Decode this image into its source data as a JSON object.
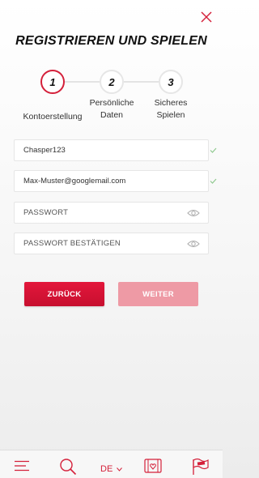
{
  "header": {
    "title": "REGISTRIEREN UND SPIELEN"
  },
  "steps": [
    {
      "number": "1",
      "label": "Kontoerstellung",
      "active": true
    },
    {
      "number": "2",
      "label_line1": "Persönliche",
      "label_line2": "Daten",
      "active": false
    },
    {
      "number": "3",
      "label_line1": "Sicheres",
      "label_line2": "Spielen",
      "active": false
    }
  ],
  "form": {
    "username_value": "Chasper123",
    "email_value": "Max-Muster@googlemail.com",
    "password_placeholder": "PASSWORT",
    "confirm_password_placeholder": "PASSWORT BESTÄTIGEN"
  },
  "buttons": {
    "back_label": "ZURÜCK",
    "next_label": "WEITER"
  },
  "bottom_nav": {
    "language": "DE"
  },
  "colors": {
    "accent": "#d4203a",
    "check": "#8fc98f",
    "next_disabled": "#ee9aa5"
  },
  "icons": {
    "close": "close-icon",
    "check": "check-icon",
    "eye": "eye-icon",
    "menu": "hamburger-menu-icon",
    "search": "search-icon",
    "cards": "cards-icon",
    "promo": "flag-promo-icon"
  }
}
